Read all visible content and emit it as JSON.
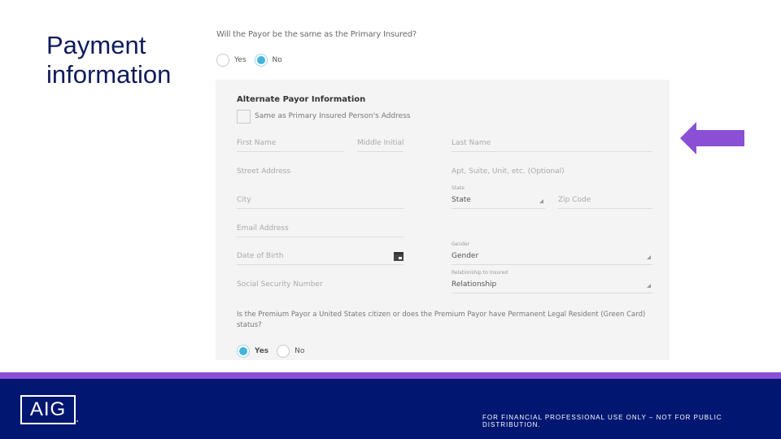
{
  "slide": {
    "title_line1": "Payment",
    "title_line2": "information"
  },
  "payor_question": {
    "text": "Will the Payor be the same as the Primary Insured?",
    "options": [
      {
        "label": "Yes",
        "selected": false
      },
      {
        "label": "No",
        "selected": true
      }
    ]
  },
  "alternate_payor": {
    "title": "Alternate Payor Information",
    "same_address_checkbox": {
      "label": "Same as Primary Insured Person's Address",
      "checked": false
    },
    "fields": {
      "first_name": {
        "placeholder": "First Name"
      },
      "middle_initial": {
        "placeholder": "Middle Initial"
      },
      "last_name": {
        "placeholder": "Last Name"
      },
      "street_address": {
        "placeholder": "Street Address"
      },
      "apt": {
        "placeholder": "Apt, Suite, Unit, etc. (Optional)"
      },
      "city": {
        "placeholder": "City"
      },
      "state": {
        "label": "State",
        "value": "State"
      },
      "zip": {
        "placeholder": "Zip Code"
      },
      "email": {
        "placeholder": "Email Address"
      },
      "dob": {
        "placeholder": "Date of Birth",
        "icon": "calendar-icon"
      },
      "gender": {
        "label": "Gender",
        "value": "Gender"
      },
      "ssn": {
        "placeholder": "Social Security Number"
      },
      "relationship": {
        "label": "Relationship to Insured",
        "value": "Relationship"
      }
    },
    "citizen_question": {
      "text": "Is the Premium Payor a United States citizen or does the Premium Payor have Permanent Legal Resident (Green Card) status?",
      "options": [
        {
          "label": "Yes",
          "selected": true
        },
        {
          "label": "No",
          "selected": false
        }
      ]
    }
  },
  "callout_arrow": {
    "icon": "arrow-left-icon",
    "color": "#8a4fd4"
  },
  "footer": {
    "logo": "AIG",
    "disclaimer": "FOR FINANCIAL PROFESSIONAL USE ONLY – NOT FOR PUBLIC DISTRIBUTION.",
    "stripe_color": "#8a4fd4",
    "background_color": "#001670"
  }
}
